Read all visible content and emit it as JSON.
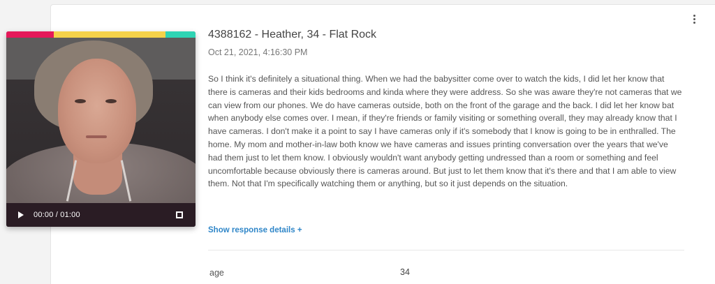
{
  "response": {
    "title": "4388162 - Heather, 34 - Flat Rock",
    "timestamp": "Oct 21, 2021, 4:16:30 PM",
    "transcript": "So I think it's definitely a situational thing. When we had the babysitter come over to watch the kids, I did let her know that there is cameras and their kids bedrooms and kinda where they were address. So she was aware they're not cameras that we can view from our phones. We do have cameras outside, both on the front of the garage and the back. I did let her know bat when anybody else comes over. I mean, if they're friends or family visiting or something overall, they may already know that I have cameras. I don't make it a point to say I have cameras only if it's somebody that I know is going to be in enthralled. The home. My mom and mother-in-law both know we have cameras and issues printing conversation over the years that we've had them just to let them know. I obviously wouldn't want anybody getting undressed than a room or something and feel uncomfortable because obviously there is cameras around. But just to let them know that it's there and that I am able to view them. Not that I'm specifically watching them or anything, but so it just depends on the situation.",
    "details_link": "Show response details +",
    "attributes": [
      {
        "label": "age",
        "value": "34"
      }
    ]
  },
  "video": {
    "time_display": "00:00 / 01:00",
    "progress": 0,
    "color_strip": [
      {
        "color": "#e5195a",
        "weight": 0.25
      },
      {
        "color": "#f5d24a",
        "weight": 0.59
      },
      {
        "color": "#2fd4b4",
        "weight": 0.16
      }
    ],
    "icons": {
      "play": "play-icon",
      "fullscreen": "fullscreen-icon",
      "menu": "more-vert-icon"
    }
  },
  "colors": {
    "link": "#2f86c8",
    "controls_bg": "#2a1c24"
  }
}
